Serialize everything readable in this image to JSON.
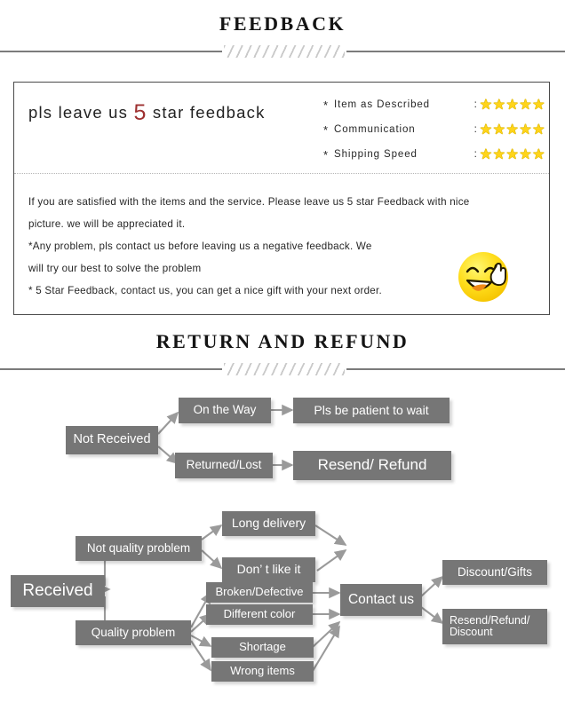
{
  "sections": {
    "feedback": {
      "title": "FEEDBACK",
      "headline_before": "pls leave us ",
      "headline_number": "5",
      "headline_after": " star feedback",
      "ratings": [
        {
          "asterisk": "*",
          "label": "Item as Described",
          "colon": ":",
          "stars": "★★★★★",
          "value": 5
        },
        {
          "asterisk": "*",
          "label": "Communication",
          "colon": ":",
          "stars": "★★★★★",
          "value": 5
        },
        {
          "asterisk": "*",
          "label": "Shipping Speed",
          "colon": ":",
          "stars": "★★★★★",
          "value": 5
        }
      ],
      "body_lines": [
        "If you are satisfied with the items and the service. Please leave us 5 star Feedback with nice",
        "picture. we will be appreciated it.",
        "*Any problem, pls contact us before leaving us a negative feedback. We",
        "will try our best to solve   the problem",
        "* 5 Star Feedback, contact us, you can get a nice gift with your next order."
      ],
      "smiley_icon": "smiley-victory-icon"
    },
    "return_refund": {
      "title": "RETURN AND REFUND",
      "flow_not_received": {
        "root": "Not Received",
        "branch_on_the_way": "On the Way",
        "branch_on_the_way_result": "Pls be patient to wait",
        "branch_returned_lost": "Returned/Lost",
        "branch_returned_lost_result": "Resend/ Refund"
      },
      "flow_received": {
        "root": "Received",
        "not_quality_problem": "Not quality problem",
        "quality_problem": "Quality problem",
        "not_quality_children": [
          "Long delivery",
          "Don’ t like it"
        ],
        "quality_children": [
          "Broken/Defective",
          "Different color",
          "Shortage",
          "Wrong items"
        ],
        "contact": "Contact us",
        "outcomes": [
          "Discount/Gifts",
          "Resend/Refund/\nDiscount"
        ],
        "outcome_1": "Discount/Gifts",
        "outcome_2_line1": "Resend/Refund/",
        "outcome_2_line2": "Discount"
      }
    }
  },
  "colors": {
    "node_fill": "#767676",
    "node_text": "#ffffff",
    "star": "#ffd41a",
    "accent_red": "#9e3030",
    "divider": "#7b7b7b",
    "box_border": "#4a4a4a"
  }
}
